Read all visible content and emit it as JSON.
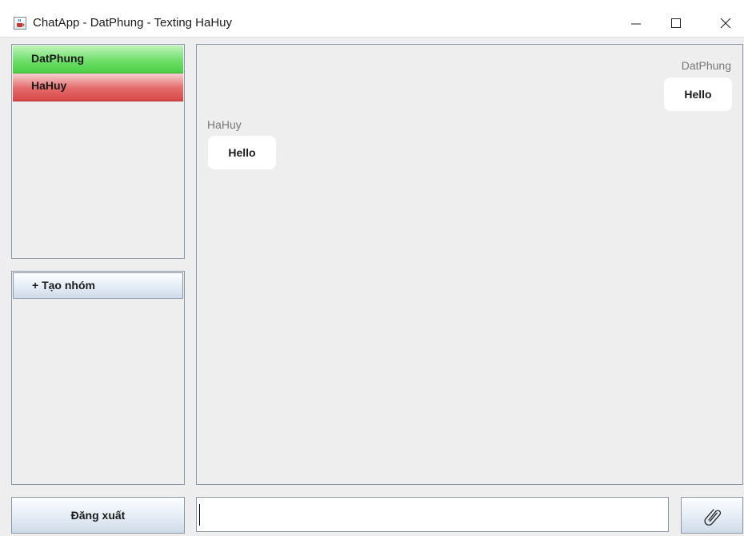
{
  "window": {
    "title": "ChatApp - DatPhung - Texting HaHuy",
    "icon": "java-cup-icon",
    "controls": [
      "minimize-icon",
      "maximize-icon",
      "close-icon"
    ]
  },
  "sidebar": {
    "users": [
      {
        "label": "DatPhung",
        "color": "#4bcf46"
      },
      {
        "label": "HaHuy",
        "color": "#d94848"
      }
    ],
    "create_group_label": "+ Tạo nhóm"
  },
  "chat": {
    "messages": [
      {
        "sender": "DatPhung",
        "text": "Hello",
        "side": "right"
      },
      {
        "sender": "HaHuy",
        "text": "Hello",
        "side": "left"
      }
    ]
  },
  "footer": {
    "logout_label": "Đăng xuất",
    "message_value": "",
    "attach_icon": "paperclip-icon"
  }
}
